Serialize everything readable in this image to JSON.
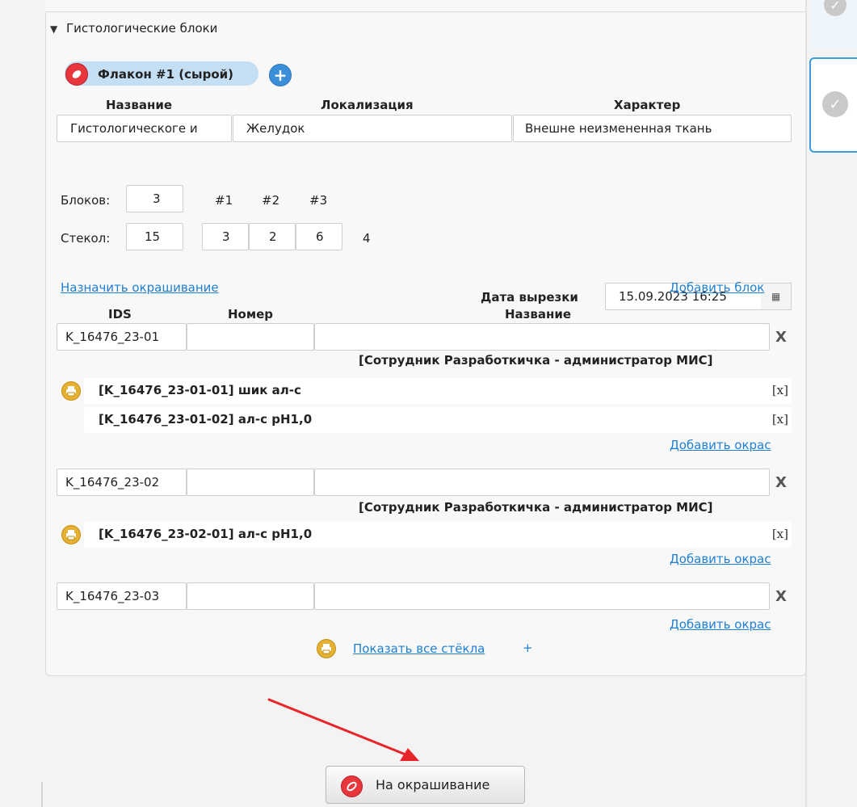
{
  "section": {
    "title": "Гистологические блоки"
  },
  "vial": {
    "label": "Флакон #1 (сырой)"
  },
  "headers": {
    "name": "Название",
    "localization": "Локализация",
    "character": "Характер"
  },
  "fields": {
    "name_value": "Гистологическоге и",
    "localization_value": "Желудок",
    "character_value": "Внешне неизмененная ткань"
  },
  "cutout": {
    "label": "Дата вырезки",
    "value": "15.09.2023 16:25"
  },
  "counts": {
    "blocks_label": "Блоков:",
    "blocks_value": "3",
    "block_headers": [
      "#1",
      "#2",
      "#3"
    ],
    "slides_label": "Стекол:",
    "slides_value": "15",
    "slides_per_block": [
      "3",
      "2",
      "6"
    ],
    "remaining": "4"
  },
  "links": {
    "assign_stain": "Назначить окрашивание",
    "add_block": "Добавить блок",
    "add_stain": "Добавить окрас",
    "show_all": "Показать все стёкла",
    "plus": "+"
  },
  "table_headers": {
    "ids": "IDS",
    "number": "Номер",
    "name": "Название"
  },
  "blocks": [
    {
      "ids": "K_16476_23-01",
      "number": "",
      "name": "",
      "owner": "[Сотрудник Разработкичка - администратор МИС]",
      "slides": [
        {
          "text": "[K_16476_23-01-01] шик ал-с",
          "remove": "[x]"
        },
        {
          "text": "[K_16476_23-01-02] ал-с рН1,0",
          "remove": "[x]"
        }
      ]
    },
    {
      "ids": "K_16476_23-02",
      "number": "",
      "name": "",
      "owner": "[Сотрудник Разработкичка - администратор МИС]",
      "slides": [
        {
          "text": "[K_16476_23-02-01] ал-с рН1,0",
          "remove": "[x]"
        }
      ]
    },
    {
      "ids": "K_16476_23-03",
      "number": "",
      "name": ""
    }
  ],
  "remove_block_label": "X",
  "submit": {
    "label": "На окрашивание"
  },
  "colors": {
    "accent": "#1f7fd4",
    "vial": "#e8363d",
    "printer": "#e6b033",
    "arrow": "#e8242b"
  }
}
